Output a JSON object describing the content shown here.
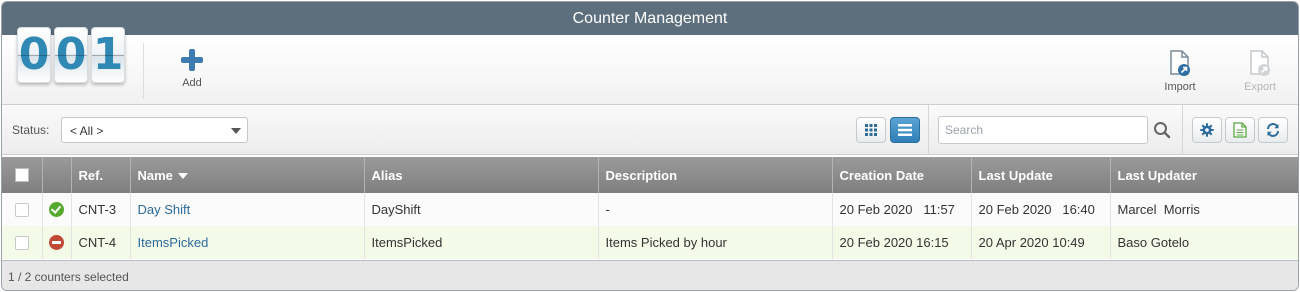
{
  "window": {
    "title": "Counter Management"
  },
  "logo": {
    "digits": [
      "0",
      "0",
      "1"
    ]
  },
  "toolbar": {
    "add_label": "Add",
    "import_label": "Import",
    "export_label": "Export"
  },
  "filter": {
    "status_label": "Status:",
    "status_value": "< All >",
    "search_placeholder": "Search"
  },
  "table": {
    "columns": [
      "Ref.",
      "Name",
      "Alias",
      "Description",
      "Creation Date",
      "Last Update",
      "Last Updater"
    ],
    "sorted_column": "Name",
    "rows": [
      {
        "status": "active",
        "ref": "CNT-3",
        "name": "Day Shift",
        "alias": "DayShift",
        "description": "-",
        "created": "20 Feb 2020   11:57",
        "updated": "20 Feb 2020   16:40",
        "updater": "Marcel  Morris"
      },
      {
        "status": "inactive",
        "ref": "CNT-4",
        "name": "ItemsPicked",
        "alias": "ItemsPicked",
        "description": "Items Picked by hour",
        "created": "20 Feb 2020 16:15",
        "updated": "20 Apr 2020 10:49",
        "updater": "Baso Gotelo"
      }
    ]
  },
  "footer": {
    "selection_text": "1 / 2 counters selected"
  },
  "colors": {
    "titlebar": "#5d6f7c",
    "accent": "#2f89b4",
    "link": "#2b6a9b",
    "ok": "#54a92f",
    "stop": "#c04a35"
  },
  "icons": [
    "add-icon",
    "import-icon",
    "export-icon",
    "grid-view-icon",
    "list-view-icon",
    "search-icon",
    "gear-icon",
    "spreadsheet-icon",
    "refresh-icon",
    "check-circle-icon",
    "minus-circle-icon",
    "sort-desc-icon"
  ]
}
